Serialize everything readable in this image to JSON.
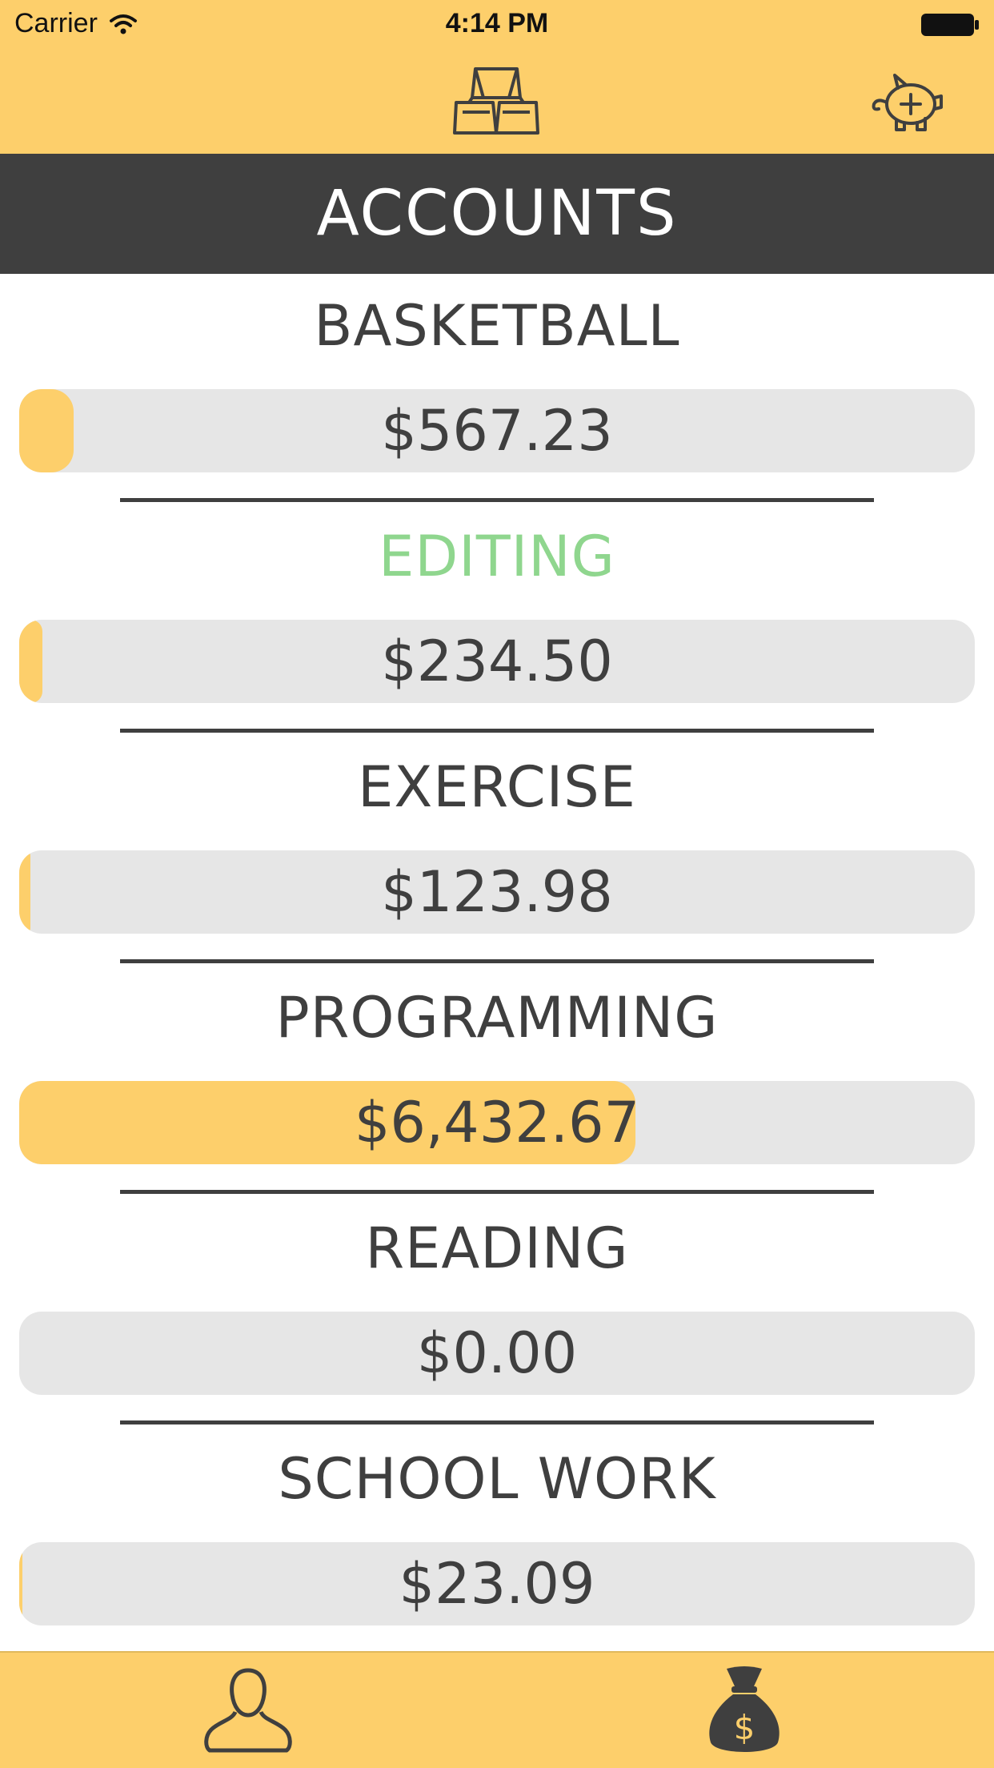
{
  "status_bar": {
    "carrier": "Carrier",
    "time": "4:14 PM"
  },
  "header": {
    "logo_icon": "gold-bars-icon",
    "add_account_icon": "piggy-bank-plus-icon",
    "title": "ACCOUNTS"
  },
  "accounts": [
    {
      "name": "BASKETBALL",
      "balance": "$567.23",
      "progress_percent": 5.7,
      "state": "normal"
    },
    {
      "name": "EDITING",
      "balance": "$234.50",
      "progress_percent": 2.4,
      "state": "editing"
    },
    {
      "name": "EXERCISE",
      "balance": "$123.98",
      "progress_percent": 1.2,
      "state": "normal"
    },
    {
      "name": "PROGRAMMING",
      "balance": "$6,432.67",
      "progress_percent": 64.5,
      "state": "normal"
    },
    {
      "name": "READING",
      "balance": "$0.00",
      "progress_percent": 0,
      "state": "normal"
    },
    {
      "name": "SCHOOL WORK",
      "balance": "$23.09",
      "progress_percent": 0.3,
      "state": "normal"
    }
  ],
  "tab_bar": {
    "tabs": [
      {
        "icon": "person-icon"
      },
      {
        "icon": "money-bag-icon"
      }
    ]
  },
  "colors": {
    "accent_yellow": "#fdcf6b",
    "dark_gray": "#3f3f3f",
    "track_gray": "#e6e6e6",
    "editing_green": "#8fd68e"
  }
}
